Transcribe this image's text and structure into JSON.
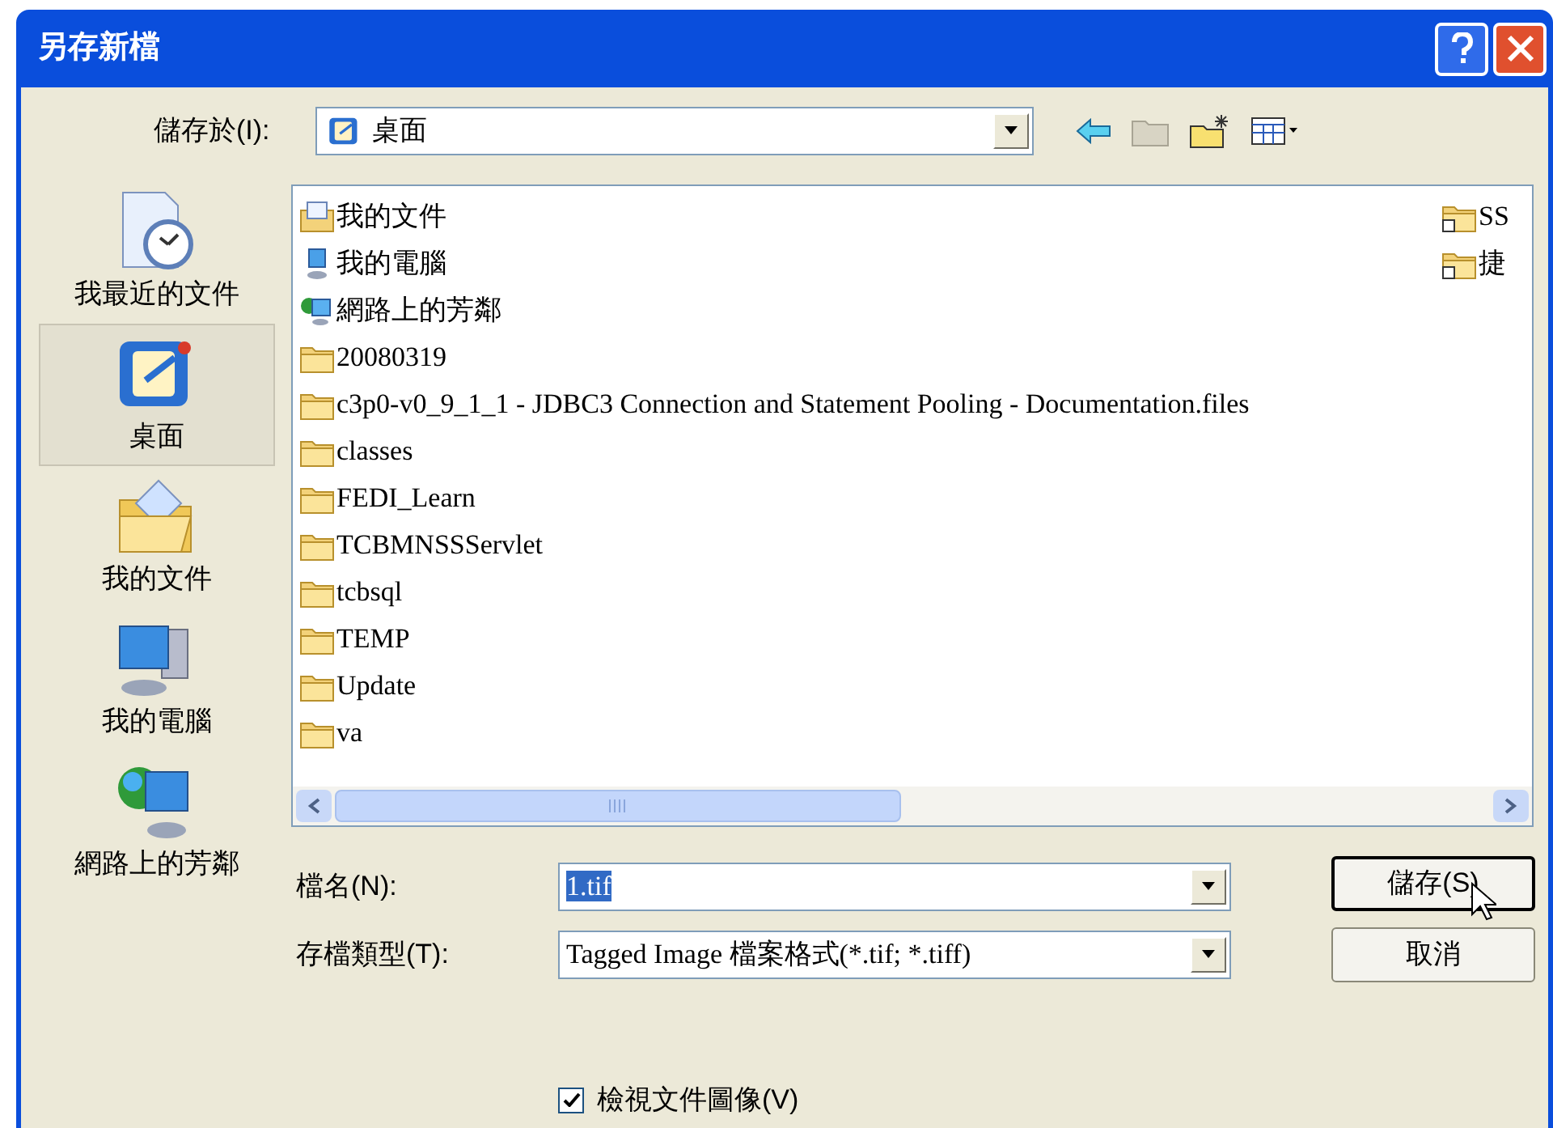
{
  "window": {
    "title": "另存新檔"
  },
  "save_in": {
    "label": "儲存於(I):",
    "value": "桌面"
  },
  "places": [
    {
      "label": "我最近的文件",
      "kind": "recent",
      "selected": false
    },
    {
      "label": "桌面",
      "kind": "desktop",
      "selected": true
    },
    {
      "label": "我的文件",
      "kind": "documents",
      "selected": false
    },
    {
      "label": "我的電腦",
      "kind": "computer",
      "selected": false
    },
    {
      "label": "網路上的芳鄰",
      "kind": "network",
      "selected": false
    }
  ],
  "files": [
    {
      "name": "我的文件",
      "kind": "documents"
    },
    {
      "name": "我的電腦",
      "kind": "computer"
    },
    {
      "name": "網路上的芳鄰",
      "kind": "network"
    },
    {
      "name": "20080319",
      "kind": "folder"
    },
    {
      "name": "c3p0-v0_9_1_1 - JDBC3 Connection and Statement Pooling - Documentation.files",
      "kind": "folder"
    },
    {
      "name": "classes",
      "kind": "folder"
    },
    {
      "name": "FEDI_Learn",
      "kind": "folder"
    },
    {
      "name": "TCBMNSSServlet",
      "kind": "folder"
    },
    {
      "name": "tcbsql",
      "kind": "folder"
    },
    {
      "name": "TEMP",
      "kind": "folder"
    },
    {
      "name": "Update",
      "kind": "folder"
    },
    {
      "name": "va",
      "kind": "folder"
    }
  ],
  "files_column_2": [
    {
      "name": "SS",
      "kind": "shortcut"
    },
    {
      "name": "捷",
      "kind": "shortcut"
    }
  ],
  "file_name": {
    "label": "檔名(N):",
    "value": "1.tif",
    "highlighted": true
  },
  "file_type": {
    "label": "存檔類型(T):",
    "value": "Tagged Image 檔案格式(*.tif; *.tiff)"
  },
  "buttons": [
    {
      "label": "儲存(S)",
      "focused": true
    },
    {
      "label": "取消",
      "focused": false
    }
  ],
  "preview": {
    "label": "檢視文件圖像(V)",
    "checked": true
  }
}
